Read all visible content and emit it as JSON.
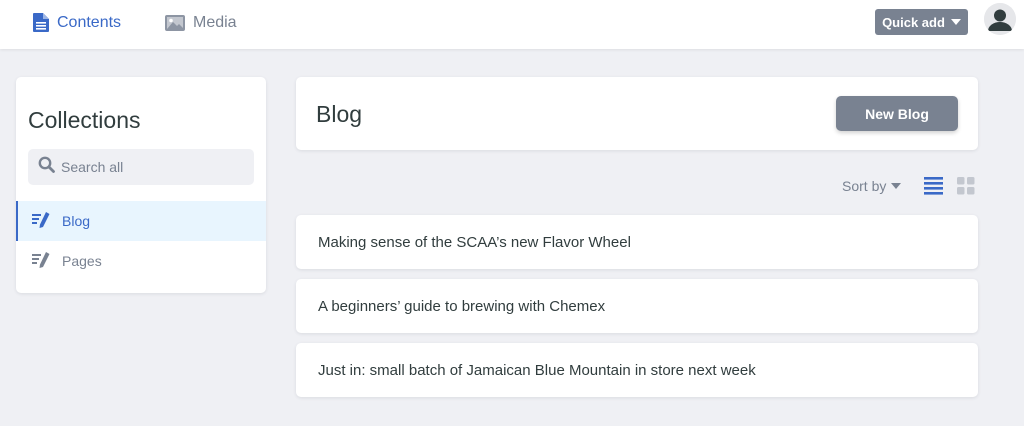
{
  "topbar": {
    "tabs": [
      {
        "label": "Contents",
        "icon": "document-icon",
        "active": true
      },
      {
        "label": "Media",
        "icon": "image-icon",
        "active": false
      }
    ],
    "quick_add_label": "Quick add",
    "avatar_icon": "user-avatar-icon"
  },
  "sidebar": {
    "title": "Collections",
    "search_placeholder": "Search all",
    "items": [
      {
        "label": "Blog",
        "icon": "edit-list-icon",
        "active": true
      },
      {
        "label": "Pages",
        "icon": "edit-list-icon",
        "active": false
      }
    ]
  },
  "main": {
    "title": "Blog",
    "new_button_label": "New Blog",
    "sort_label": "Sort by",
    "views": [
      {
        "name": "list-view",
        "active": true
      },
      {
        "name": "grid-view",
        "active": false
      }
    ],
    "entries": [
      "Making sense of the SCAA’s new Flavor Wheel",
      "A beginners’ guide to brewing with Chemex",
      "Just in: small batch of Jamaican Blue Mountain in store next week"
    ]
  },
  "colors": {
    "accent": "#3a69c7",
    "muted": "#798291",
    "background": "#eff0f4",
    "active_item_bg": "#e8f5fe",
    "text": "#313d3e"
  }
}
